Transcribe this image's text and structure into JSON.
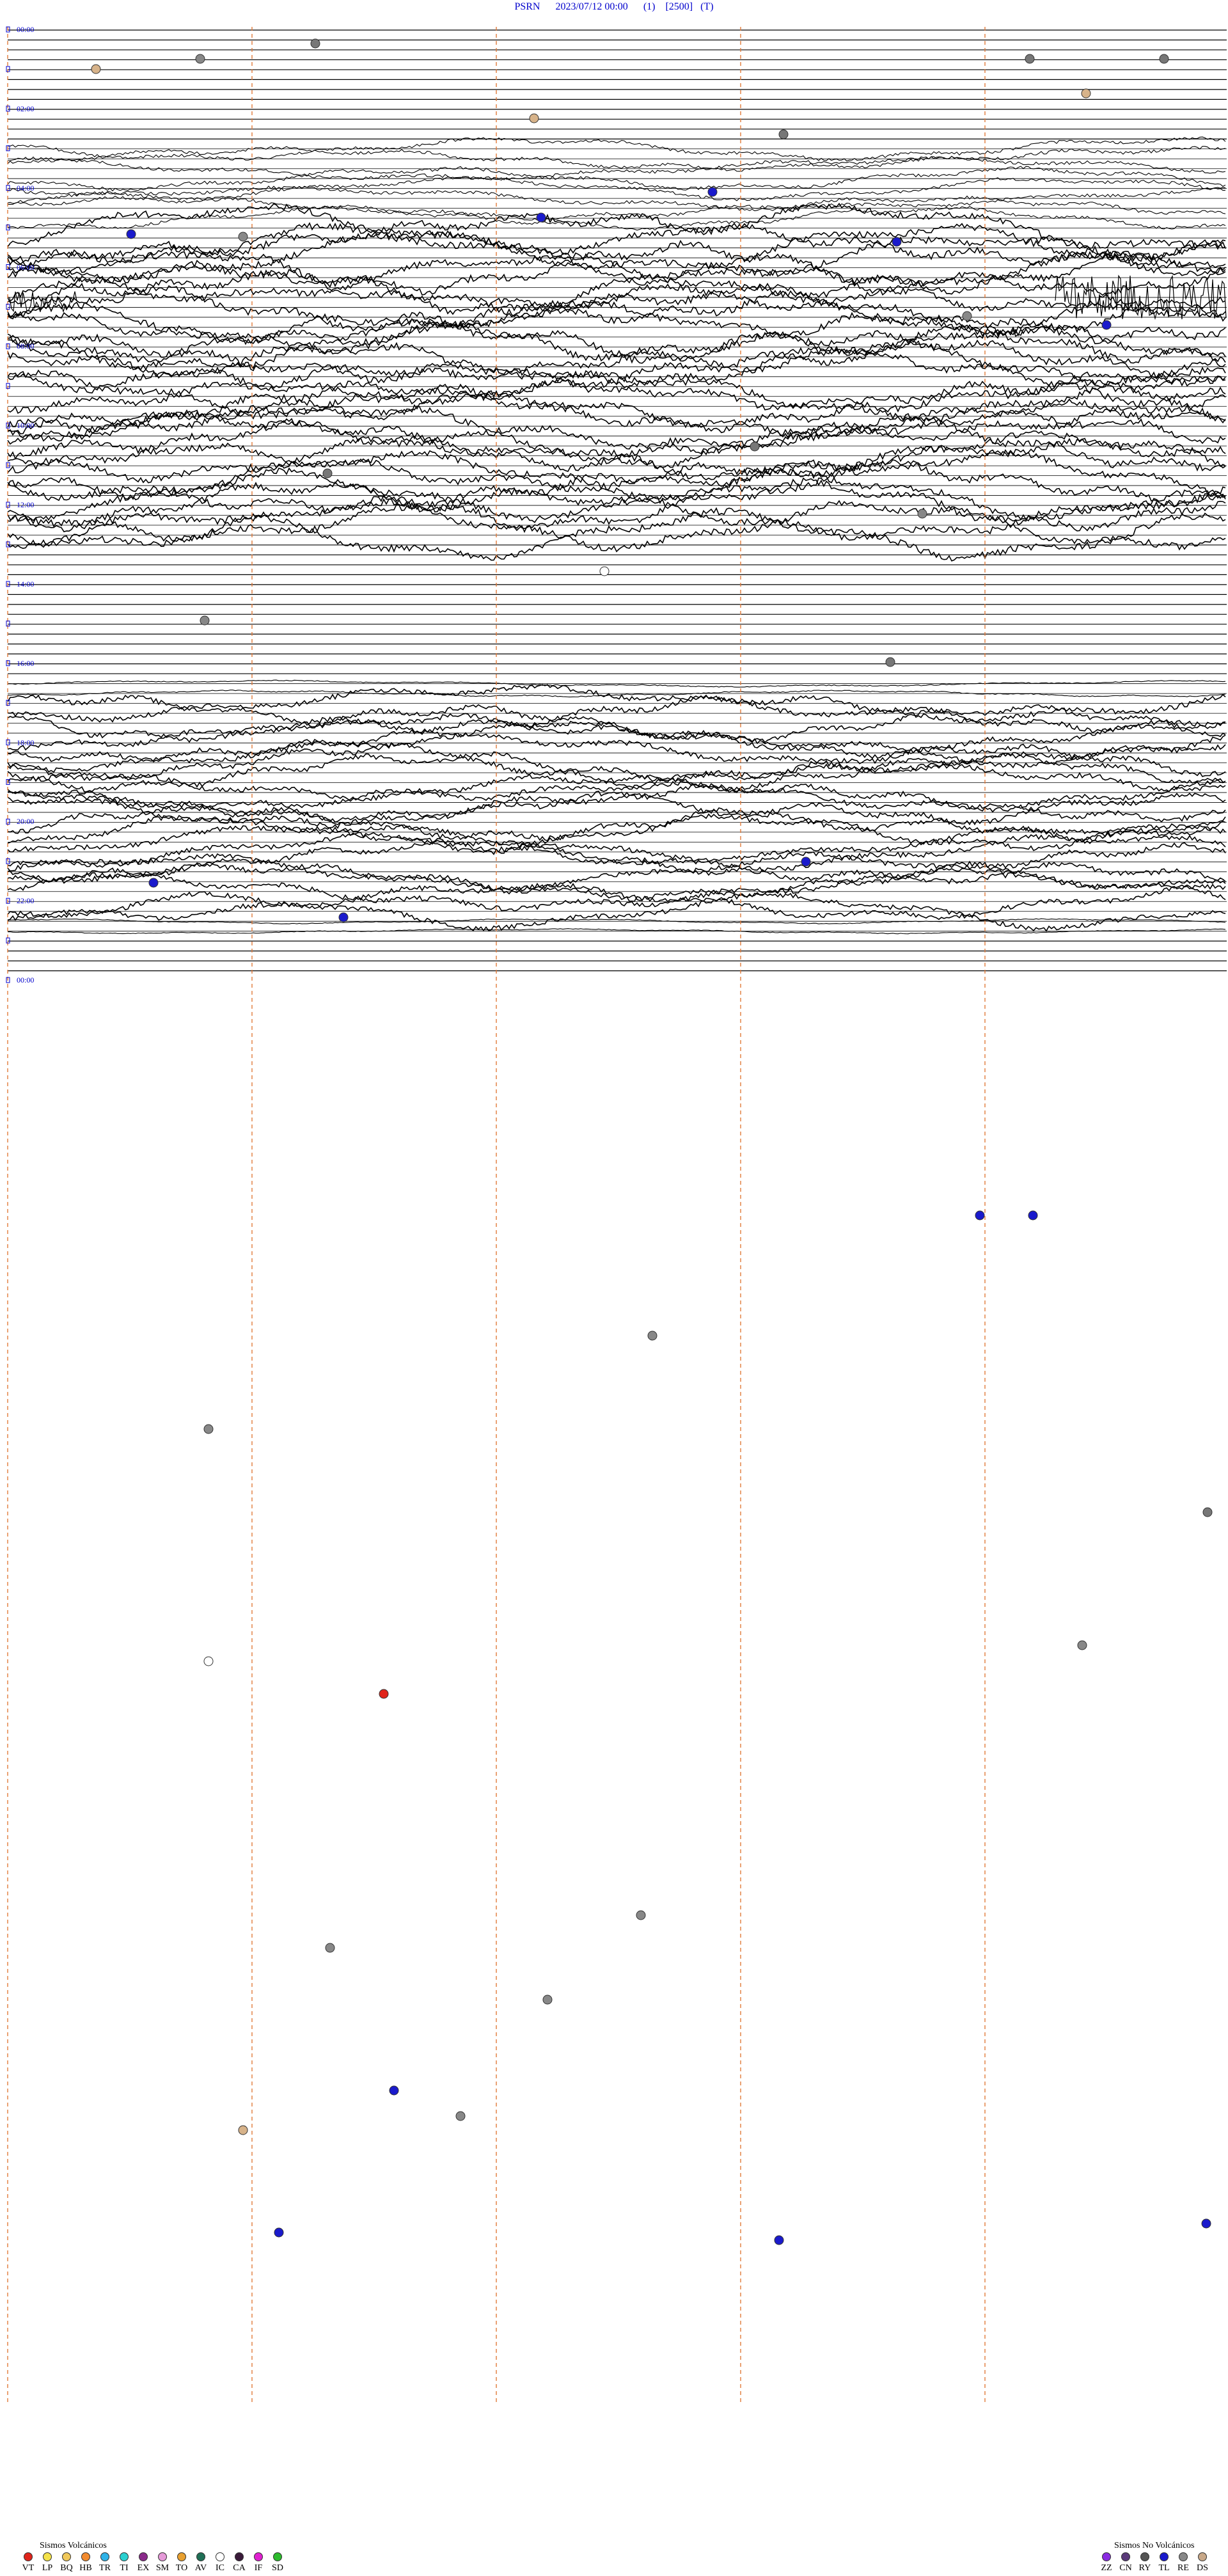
{
  "header": {
    "station": "PSRN",
    "datetime": "2023/07/12 00:00",
    "channel": "(1)",
    "scale": "[2500]",
    "mode": "(T)"
  },
  "time_labels": [
    "00:00",
    "02:00",
    "04:00",
    "06:00",
    "08:00",
    "10:00",
    "12:00",
    "14:00",
    "16:00",
    "18:00",
    "20:00",
    "22:00",
    "00:00"
  ],
  "legend_volcanic": {
    "title": "Sismos Volcánicos",
    "items": [
      {
        "code": "VT",
        "color": "#e0241b"
      },
      {
        "code": "LP",
        "color": "#f4e24a"
      },
      {
        "code": "BQ",
        "color": "#f0c85a"
      },
      {
        "code": "HB",
        "color": "#f28a2e"
      },
      {
        "code": "TR",
        "color": "#2fb3e8"
      },
      {
        "code": "TI",
        "color": "#2ad0d0"
      },
      {
        "code": "EX",
        "color": "#8a2a8a"
      },
      {
        "code": "SM",
        "color": "#e59ad8"
      },
      {
        "code": "TO",
        "color": "#e8a030"
      },
      {
        "code": "AV",
        "color": "#1f6f56"
      },
      {
        "code": "IC",
        "color": "#ffffff"
      },
      {
        "code": "CA",
        "color": "#3a1a3a"
      },
      {
        "code": "IF",
        "color": "#e020d0"
      },
      {
        "code": "SD",
        "color": "#2dbb2d"
      }
    ]
  },
  "legend_nonvolcanic": {
    "title": "Sismos No Volcánicos",
    "items": [
      {
        "code": "ZZ",
        "color": "#8a2be2"
      },
      {
        "code": "CN",
        "color": "#5a3a7a"
      },
      {
        "code": "RY",
        "color": "#555555"
      },
      {
        "code": "TL",
        "color": "#1a1acc"
      },
      {
        "code": "RE",
        "color": "#888888"
      },
      {
        "code": "DS",
        "color": "#c8a888"
      }
    ]
  }
}
